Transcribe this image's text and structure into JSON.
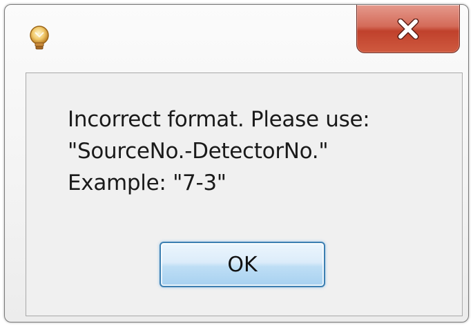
{
  "window": {
    "close_label": "close"
  },
  "message": {
    "line1": "Incorrect format. Please use:",
    "line2": "\"SourceNo.-DetectorNo.\"",
    "line3": "Example: \"7-3\""
  },
  "buttons": {
    "ok_label": "OK"
  },
  "colors": {
    "close_button": "#c9503a",
    "ok_border": "#3c7fb1",
    "client_bg": "#f0f0f0"
  },
  "icons": {
    "title_icon": "app-lightbulb-icon",
    "close_icon": "close-x-icon"
  }
}
